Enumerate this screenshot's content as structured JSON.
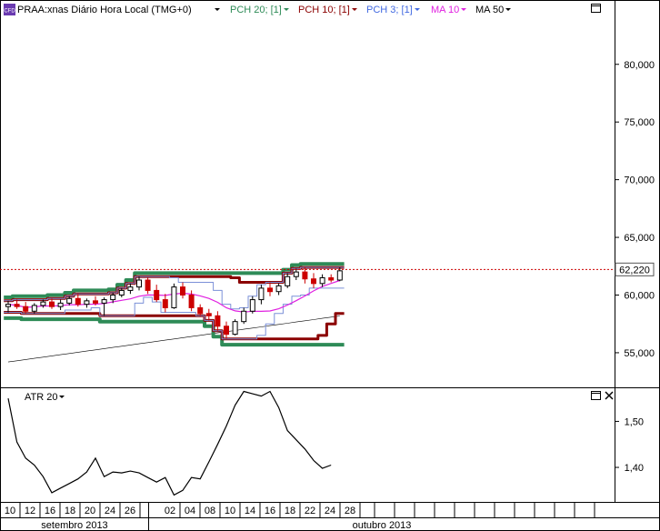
{
  "main_chart": {
    "badge": "CFD",
    "symbol_label": "PRAA:xnas Diário Hora Local (TMG+0)",
    "indicators": [
      {
        "label": "PCH 20; [1]",
        "color": "#2e8b57"
      },
      {
        "label": "PCH 10; [1]",
        "color": "#8b0000"
      },
      {
        "label": "PCH 3; [1]",
        "color": "#4169e1"
      },
      {
        "label": "MA 10",
        "color": "#e020e0"
      },
      {
        "label": "MA 50",
        "color": "#000000"
      }
    ],
    "current_price": "62,220",
    "current_price_value": 62.22,
    "price_line_color": "#cc0000"
  },
  "chart_data": [
    {
      "type": "candlestick",
      "y_ticks": [
        "80,000",
        "75,000",
        "70,000",
        "65,000",
        "60,000",
        "55,000"
      ],
      "y_tick_values": [
        80,
        75,
        70,
        65,
        60,
        55
      ],
      "ylim": [
        52.0,
        84.0
      ],
      "series": [
        {
          "name": "PRAA",
          "ohlc": [
            [
              59.0,
              59.5,
              58.5,
              59.2
            ],
            [
              59.2,
              59.6,
              58.8,
              59.0
            ],
            [
              59.0,
              59.4,
              58.4,
              58.6
            ],
            [
              58.6,
              59.3,
              58.4,
              59.1
            ],
            [
              59.1,
              59.6,
              58.9,
              59.4
            ],
            [
              59.4,
              59.7,
              58.8,
              59.0
            ],
            [
              59.0,
              59.6,
              58.7,
              59.3
            ],
            [
              59.3,
              59.9,
              59.1,
              59.7
            ],
            [
              59.7,
              60.1,
              59.0,
              59.2
            ],
            [
              59.2,
              59.7,
              58.9,
              59.5
            ],
            [
              59.5,
              59.9,
              59.1,
              59.3
            ],
            [
              59.3,
              59.8,
              58.2,
              59.6
            ],
            [
              59.6,
              60.2,
              59.3,
              60.0
            ],
            [
              60.0,
              60.6,
              59.8,
              60.4
            ],
            [
              60.4,
              61.0,
              60.1,
              60.7
            ],
            [
              60.7,
              61.6,
              60.4,
              61.3
            ],
            [
              61.3,
              61.5,
              60.1,
              60.4
            ],
            [
              60.4,
              60.9,
              59.4,
              59.6
            ],
            [
              59.6,
              60.1,
              58.5,
              58.9
            ],
            [
              58.9,
              61.0,
              58.8,
              60.7
            ],
            [
              60.7,
              61.1,
              59.7,
              60.0
            ],
            [
              60.0,
              60.4,
              58.6,
              58.9
            ],
            [
              58.9,
              59.2,
              58.2,
              58.4
            ],
            [
              58.4,
              58.8,
              57.8,
              58.2
            ],
            [
              58.2,
              58.6,
              56.9,
              57.3
            ],
            [
              57.3,
              57.7,
              56.2,
              56.6
            ],
            [
              56.6,
              57.9,
              56.5,
              57.7
            ],
            [
              57.7,
              58.9,
              57.5,
              58.6
            ],
            [
              58.6,
              59.9,
              58.4,
              59.6
            ],
            [
              59.6,
              60.9,
              59.2,
              60.6
            ],
            [
              60.6,
              61.1,
              59.9,
              60.3
            ],
            [
              60.3,
              61.0,
              60.0,
              60.8
            ],
            [
              60.8,
              61.9,
              60.6,
              61.6
            ],
            [
              61.6,
              62.3,
              61.3,
              62.0
            ],
            [
              62.0,
              62.4,
              61.0,
              61.4
            ],
            [
              61.4,
              61.9,
              60.6,
              61.0
            ],
            [
              61.0,
              61.8,
              60.7,
              61.5
            ],
            [
              61.5,
              61.8,
              61.1,
              61.3
            ],
            [
              61.3,
              62.4,
              61.2,
              62.1
            ]
          ]
        },
        {
          "name": "PCH 20; [1]",
          "values": [
            null,
            null,
            null,
            null,
            null,
            null,
            null,
            null,
            null,
            null,
            null,
            null,
            null,
            null,
            null,
            null,
            null,
            null,
            null,
            null,
            null,
            null,
            null,
            null,
            null,
            null,
            null,
            null,
            null,
            null,
            null,
            null,
            null,
            null,
            null,
            null,
            null,
            null,
            null
          ]
        },
        {
          "name": "PCH 10; [1]",
          "values": [
            null,
            null,
            null,
            null,
            null,
            null,
            null,
            null,
            null,
            null,
            null,
            null,
            null,
            null,
            null,
            null,
            null,
            null,
            null,
            null,
            null,
            null,
            null,
            null,
            null,
            null,
            null,
            null,
            null,
            null,
            null,
            null,
            null,
            null,
            null,
            null,
            null,
            null,
            null
          ]
        },
        {
          "name": "PCH 3; [1]",
          "values": [
            null,
            null,
            null,
            null,
            null,
            null,
            null,
            null,
            null,
            null,
            null,
            null,
            null,
            null,
            null,
            null,
            null,
            null,
            null,
            null,
            null,
            null,
            null,
            null,
            null,
            null,
            null,
            null,
            null,
            null,
            null,
            null,
            null,
            null,
            null,
            null,
            null,
            null,
            null
          ]
        },
        {
          "name": "MA 10",
          "values": [
            null,
            null,
            null,
            null,
            null,
            null,
            null,
            null,
            null,
            null,
            null,
            null,
            null,
            null,
            null,
            null,
            null,
            null,
            null,
            null,
            null,
            null,
            null,
            null,
            null,
            null,
            null,
            null,
            null,
            null,
            null,
            null,
            null,
            null,
            null,
            null,
            null,
            null,
            null
          ]
        },
        {
          "name": "MA 50",
          "values": [
            null,
            null,
            null,
            null,
            null,
            null,
            null,
            null,
            null,
            null,
            null,
            null,
            null,
            null,
            null,
            null,
            null,
            null,
            null,
            null,
            null,
            null,
            null,
            null,
            null,
            null,
            null,
            null,
            null,
            null,
            null,
            null,
            null,
            null,
            null,
            null,
            null,
            null,
            null
          ]
        }
      ]
    },
    {
      "type": "line",
      "title": "ATR 20",
      "y_ticks": [
        "1,50",
        "1,40"
      ],
      "y_tick_values": [
        1.5,
        1.4
      ],
      "ylim": [
        1.325,
        1.57
      ],
      "series": [
        {
          "name": "ATR 20",
          "values": [
            1.55,
            1.455,
            1.42,
            1.405,
            1.38,
            1.345,
            1.355,
            1.365,
            1.375,
            1.39,
            1.42,
            1.38,
            1.39,
            1.388,
            1.392,
            1.388,
            1.378,
            1.368,
            1.378,
            1.34,
            1.35,
            1.378,
            1.375,
            1.412,
            1.45,
            1.49,
            1.535,
            1.565,
            1.56,
            1.555,
            1.565,
            1.53,
            1.48,
            1.46,
            1.44,
            1.415,
            1.398,
            1.405
          ]
        }
      ]
    }
  ],
  "x_axis": {
    "day_labels": [
      "10",
      "12",
      "16",
      "18",
      "20",
      "24",
      "26",
      "02",
      "04",
      "08",
      "10",
      "14",
      "16",
      "18",
      "22",
      "24",
      "28"
    ],
    "month_labels": [
      "setembro 2013",
      "outubro 2013"
    ]
  },
  "atr_panel": {
    "title": "ATR 20"
  }
}
